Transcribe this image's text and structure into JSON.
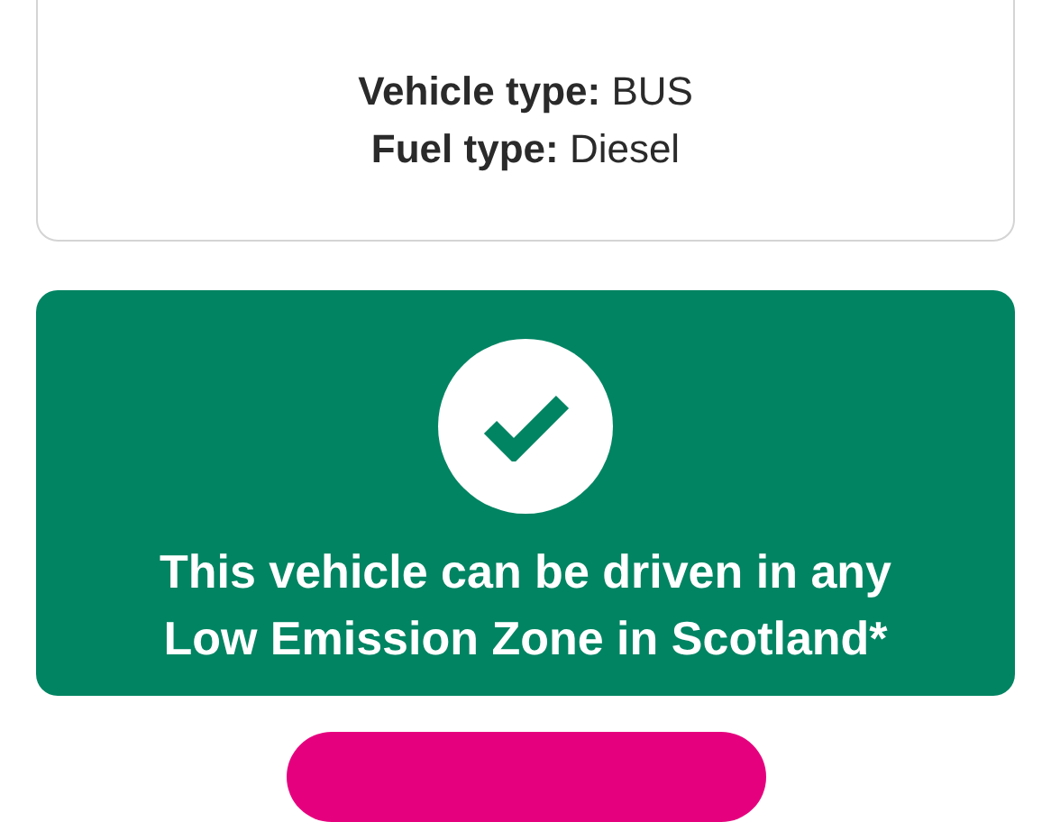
{
  "vehicle_details": [
    {
      "text": "**Vehicle type:** BUS"
    },
    {
      "text": "**Fuel type:** Diesel"
    }
  ],
  "result": {
    "kind": "compliant",
    "message": "This vehicle can be driven in any Low Emission Zone in Scotland*"
  }
}
